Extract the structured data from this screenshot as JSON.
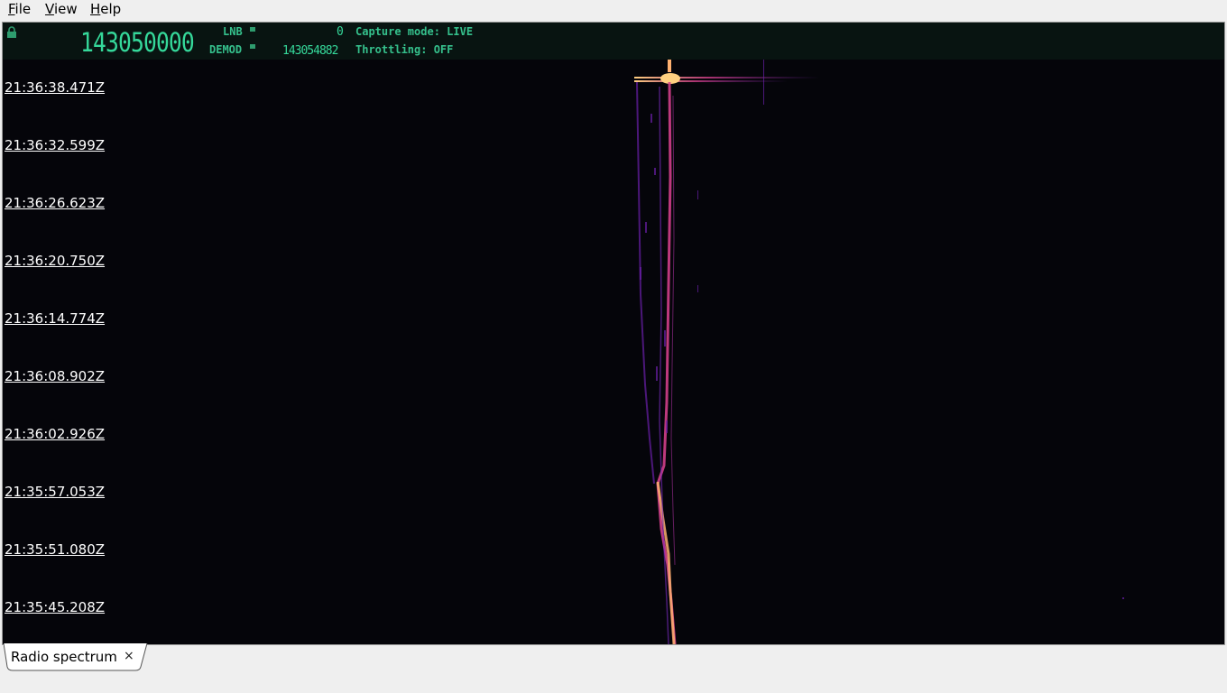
{
  "menu": {
    "file": {
      "first": "F",
      "rest": "ile"
    },
    "view": {
      "first": "V",
      "rest": "iew"
    },
    "help": {
      "first": "H",
      "rest": "elp"
    }
  },
  "header": {
    "main_frequency": "143050000",
    "lnb_label": "LNB",
    "lnb_value": "0",
    "demod_label": "DEMOD",
    "demod_value": "143054882",
    "capture_mode": "Capture mode: LIVE",
    "throttling": "Throttling: OFF"
  },
  "timestamps": [
    "21:36:38.471Z",
    "21:36:32.599Z",
    "21:36:26.623Z",
    "21:36:20.750Z",
    "21:36:14.774Z",
    "21:36:08.902Z",
    "21:36:02.926Z",
    "21:35:57.053Z",
    "21:35:51.080Z",
    "21:35:45.208Z"
  ],
  "tab": {
    "label": "Radio spectrum",
    "close": "×"
  },
  "colors": {
    "background": "#05050a",
    "header_text": "#35c08c",
    "signal_low": "#6a1fa8",
    "signal_mid": "#d23f8a",
    "signal_high": "#ffd080"
  }
}
